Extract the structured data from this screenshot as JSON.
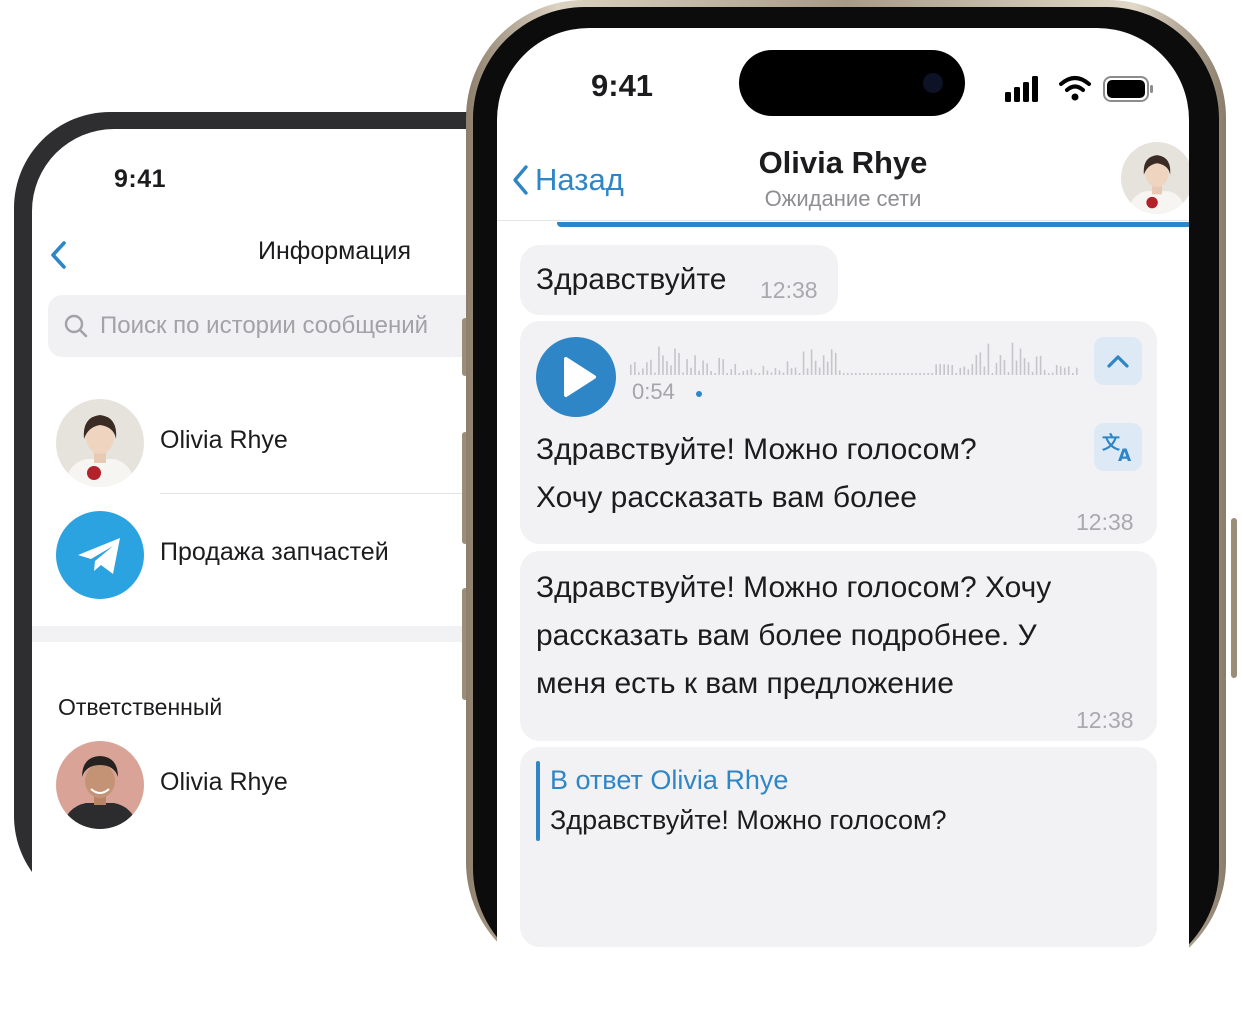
{
  "info_screen": {
    "status_time": "9:41",
    "title": "Информация",
    "search_placeholder": "Поиск по истории сообщений",
    "contact_name": "Olivia Rhye",
    "channel_name": "Продажа запчастей",
    "section_label": "Ответственный",
    "responsible_name": "Olivia Rhye"
  },
  "chat_screen": {
    "status_time": "9:41",
    "back_label": "Назад",
    "contact_name": "Olivia Rhye",
    "status": "Ожидание сети",
    "messages": [
      {
        "text": "Здравствуйте",
        "time": "12:38"
      },
      {
        "voice_duration": "0:54",
        "transcript_line1": "Здравствуйте! Можно голосом?",
        "transcript_line2": "Хочу рассказать вам более",
        "time": "12:38"
      },
      {
        "line1": "Здравствуйте! Можно голосом? Хочу",
        "line2": "рассказать вам более подробнее. У",
        "line3": "меня есть к вам предложение",
        "time": "12:38"
      },
      {
        "reply_to": "В ответ Olivia Rhye",
        "reply_quote": "Здравствуйте! Можно голосом?"
      }
    ]
  },
  "colors": {
    "accent": "#2f86c7",
    "bubble": "#f2f2f4",
    "telegram": "#2aa3e0",
    "muted_text": "#8e8e93"
  }
}
